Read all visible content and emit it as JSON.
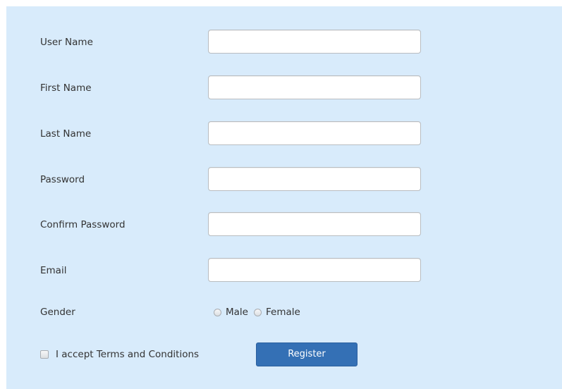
{
  "form": {
    "fields": [
      {
        "label": "User Name",
        "value": "",
        "placeholder": ""
      },
      {
        "label": "First Name",
        "value": "",
        "placeholder": ""
      },
      {
        "label": "Last Name",
        "value": "",
        "placeholder": ""
      },
      {
        "label": "Password",
        "value": "",
        "placeholder": ""
      },
      {
        "label": "Confirm Password",
        "value": "",
        "placeholder": ""
      },
      {
        "label": "Email",
        "value": "",
        "placeholder": ""
      }
    ],
    "gender": {
      "label": "Gender",
      "options": [
        "Male",
        "Female"
      ],
      "selected": null
    },
    "terms": {
      "label": "I accept Terms and Conditions",
      "checked": false
    },
    "register_label": "Register"
  },
  "colors": {
    "panel_background": "#d8ebfb",
    "button_background": "#3470b5",
    "button_text": "#ffffff",
    "label_text": "#333333"
  }
}
